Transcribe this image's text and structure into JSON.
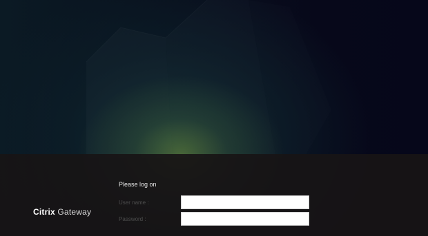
{
  "brand": {
    "product_bold": "Citrix",
    "product_light": "Gateway"
  },
  "login": {
    "prompt": "Please log on",
    "username_label": "User name :",
    "username_value": "",
    "password_label": "Password :",
    "password_value": ""
  },
  "colors": {
    "background": "#07081a",
    "band": "#181416",
    "glow": "#70943a"
  }
}
